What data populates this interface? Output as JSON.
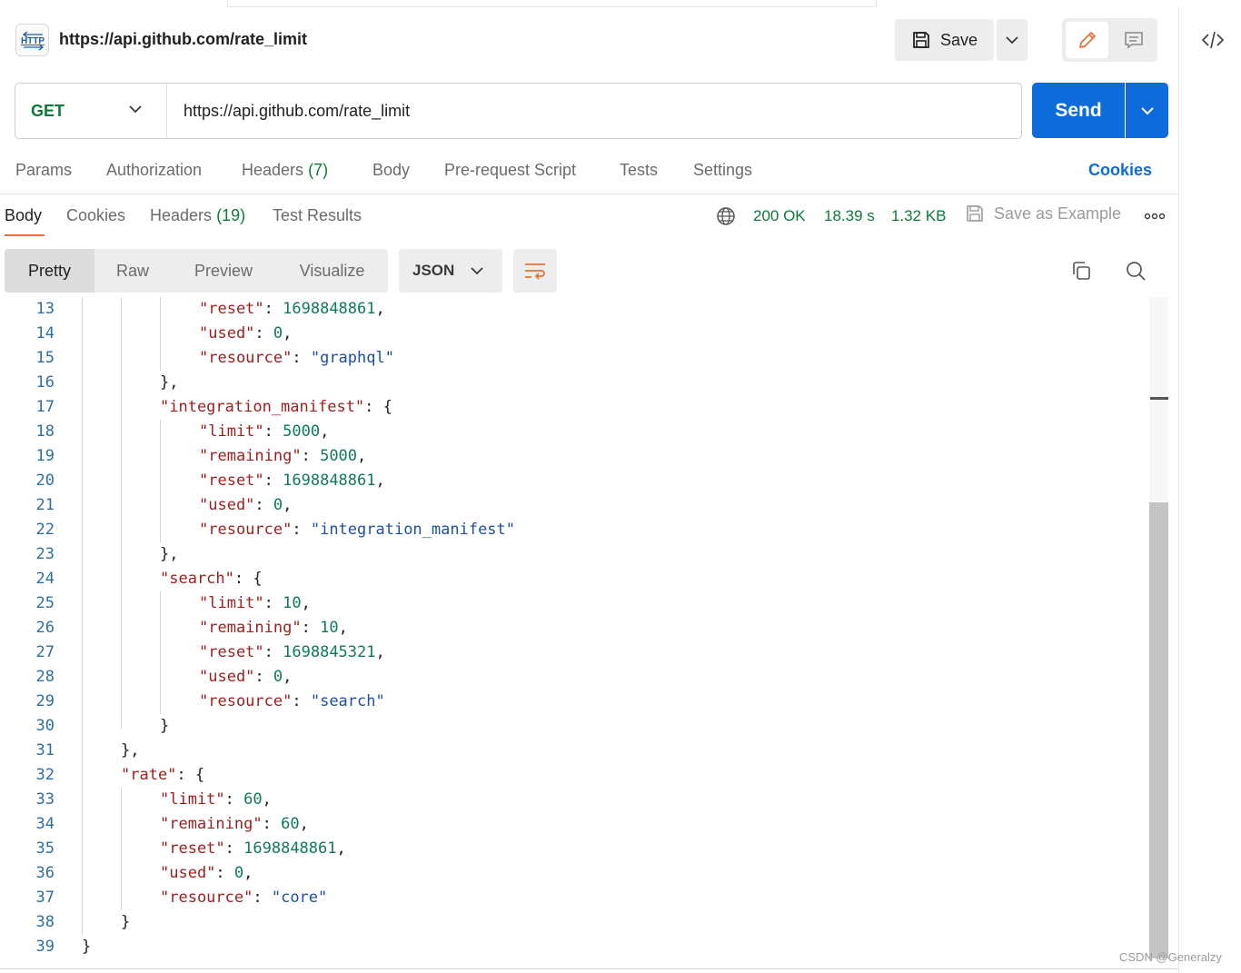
{
  "header": {
    "title": "https://api.github.com/rate_limit",
    "save_label": "Save",
    "http_badge": "HTTP"
  },
  "url_bar": {
    "method": "GET",
    "url": "https://api.github.com/rate_limit",
    "send_label": "Send"
  },
  "request_tabs": {
    "params": "Params",
    "authorization": "Authorization",
    "headers": "Headers",
    "headers_count": "(7)",
    "body": "Body",
    "prerequest": "Pre-request Script",
    "tests": "Tests",
    "settings": "Settings",
    "cookies": "Cookies"
  },
  "response_tabs": {
    "body": "Body",
    "cookies": "Cookies",
    "headers": "Headers",
    "headers_count": "(19)",
    "test_results": "Test Results"
  },
  "response_meta": {
    "status": "200 OK",
    "time": "18.39 s",
    "size": "1.32 KB",
    "save_example": "Save as Example"
  },
  "format_tabs": {
    "pretty": "Pretty",
    "raw": "Raw",
    "preview": "Preview",
    "visualize": "Visualize",
    "language": "JSON"
  },
  "code_lines": [
    {
      "n": "13",
      "indent": 5,
      "t": [
        [
          "k",
          "\"reset\""
        ],
        [
          "p",
          ": "
        ],
        [
          "n",
          "1698848861"
        ],
        [
          "p",
          ","
        ]
      ]
    },
    {
      "n": "14",
      "indent": 5,
      "t": [
        [
          "k",
          "\"used\""
        ],
        [
          "p",
          ": "
        ],
        [
          "n",
          "0"
        ],
        [
          "p",
          ","
        ]
      ]
    },
    {
      "n": "15",
      "indent": 5,
      "t": [
        [
          "k",
          "\"resource\""
        ],
        [
          "p",
          ": "
        ],
        [
          "s",
          "\"graphql\""
        ]
      ]
    },
    {
      "n": "16",
      "indent": 4,
      "t": [
        [
          "p",
          "},"
        ]
      ]
    },
    {
      "n": "17",
      "indent": 4,
      "t": [
        [
          "k",
          "\"integration_manifest\""
        ],
        [
          "p",
          ": {"
        ]
      ]
    },
    {
      "n": "18",
      "indent": 5,
      "t": [
        [
          "k",
          "\"limit\""
        ],
        [
          "p",
          ": "
        ],
        [
          "n",
          "5000"
        ],
        [
          "p",
          ","
        ]
      ]
    },
    {
      "n": "19",
      "indent": 5,
      "t": [
        [
          "k",
          "\"remaining\""
        ],
        [
          "p",
          ": "
        ],
        [
          "n",
          "5000"
        ],
        [
          "p",
          ","
        ]
      ]
    },
    {
      "n": "20",
      "indent": 5,
      "t": [
        [
          "k",
          "\"reset\""
        ],
        [
          "p",
          ": "
        ],
        [
          "n",
          "1698848861"
        ],
        [
          "p",
          ","
        ]
      ]
    },
    {
      "n": "21",
      "indent": 5,
      "t": [
        [
          "k",
          "\"used\""
        ],
        [
          "p",
          ": "
        ],
        [
          "n",
          "0"
        ],
        [
          "p",
          ","
        ]
      ]
    },
    {
      "n": "22",
      "indent": 5,
      "t": [
        [
          "k",
          "\"resource\""
        ],
        [
          "p",
          ": "
        ],
        [
          "s",
          "\"integration_manifest\""
        ]
      ]
    },
    {
      "n": "23",
      "indent": 4,
      "t": [
        [
          "p",
          "},"
        ]
      ]
    },
    {
      "n": "24",
      "indent": 4,
      "t": [
        [
          "k",
          "\"search\""
        ],
        [
          "p",
          ": {"
        ]
      ]
    },
    {
      "n": "25",
      "indent": 5,
      "t": [
        [
          "k",
          "\"limit\""
        ],
        [
          "p",
          ": "
        ],
        [
          "n",
          "10"
        ],
        [
          "p",
          ","
        ]
      ]
    },
    {
      "n": "26",
      "indent": 5,
      "t": [
        [
          "k",
          "\"remaining\""
        ],
        [
          "p",
          ": "
        ],
        [
          "n",
          "10"
        ],
        [
          "p",
          ","
        ]
      ]
    },
    {
      "n": "27",
      "indent": 5,
      "t": [
        [
          "k",
          "\"reset\""
        ],
        [
          "p",
          ": "
        ],
        [
          "n",
          "1698845321"
        ],
        [
          "p",
          ","
        ]
      ]
    },
    {
      "n": "28",
      "indent": 5,
      "t": [
        [
          "k",
          "\"used\""
        ],
        [
          "p",
          ": "
        ],
        [
          "n",
          "0"
        ],
        [
          "p",
          ","
        ]
      ]
    },
    {
      "n": "29",
      "indent": 5,
      "t": [
        [
          "k",
          "\"resource\""
        ],
        [
          "p",
          ": "
        ],
        [
          "s",
          "\"search\""
        ]
      ]
    },
    {
      "n": "30",
      "indent": 4,
      "t": [
        [
          "p",
          "}"
        ]
      ]
    },
    {
      "n": "31",
      "indent": 3,
      "t": [
        [
          "p",
          "},"
        ]
      ]
    },
    {
      "n": "32",
      "indent": 3,
      "t": [
        [
          "k",
          "\"rate\""
        ],
        [
          "p",
          ": {"
        ]
      ]
    },
    {
      "n": "33",
      "indent": 4,
      "t": [
        [
          "k",
          "\"limit\""
        ],
        [
          "p",
          ": "
        ],
        [
          "n",
          "60"
        ],
        [
          "p",
          ","
        ]
      ]
    },
    {
      "n": "34",
      "indent": 4,
      "t": [
        [
          "k",
          "\"remaining\""
        ],
        [
          "p",
          ": "
        ],
        [
          "n",
          "60"
        ],
        [
          "p",
          ","
        ]
      ]
    },
    {
      "n": "35",
      "indent": 4,
      "t": [
        [
          "k",
          "\"reset\""
        ],
        [
          "p",
          ": "
        ],
        [
          "n",
          "1698848861"
        ],
        [
          "p",
          ","
        ]
      ]
    },
    {
      "n": "36",
      "indent": 4,
      "t": [
        [
          "k",
          "\"used\""
        ],
        [
          "p",
          ": "
        ],
        [
          "n",
          "0"
        ],
        [
          "p",
          ","
        ]
      ]
    },
    {
      "n": "37",
      "indent": 4,
      "t": [
        [
          "k",
          "\"resource\""
        ],
        [
          "p",
          ": "
        ],
        [
          "s",
          "\"core\""
        ]
      ]
    },
    {
      "n": "38",
      "indent": 3,
      "t": [
        [
          "p",
          "}"
        ]
      ]
    },
    {
      "n": "39",
      "indent": 2,
      "t": [
        [
          "p",
          "}"
        ]
      ]
    }
  ],
  "watermark": "CSDN @Generalzy",
  "colors": {
    "accent": "#0d6bdc",
    "success": "#0e7a3a",
    "tab_underline": "#e8713a",
    "json_key": "#a11f1f",
    "json_string": "#1f4fa3",
    "json_number": "#0e7a5a"
  }
}
